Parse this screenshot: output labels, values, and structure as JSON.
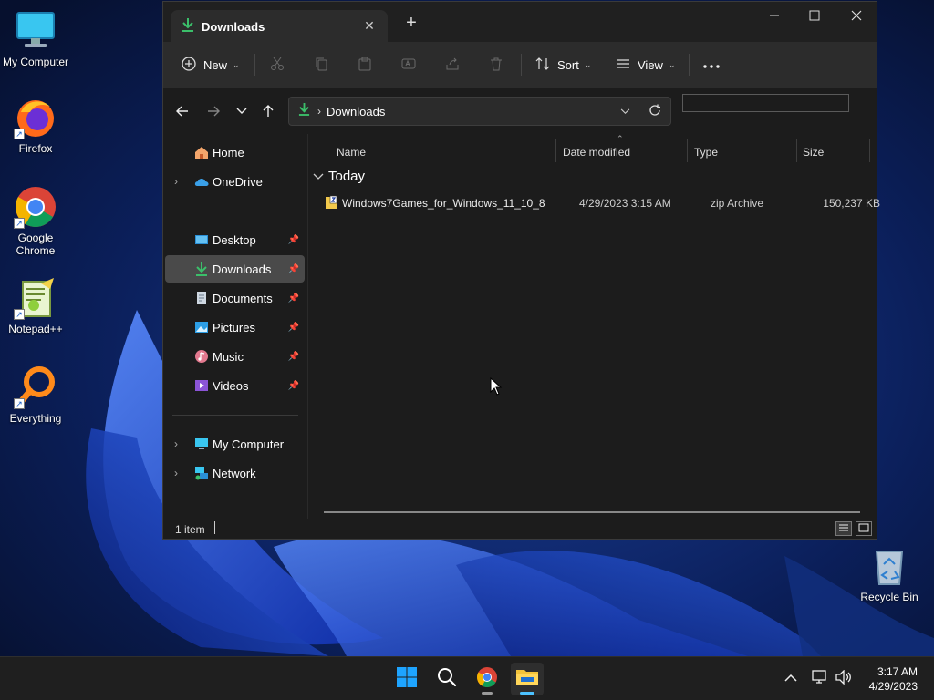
{
  "desktop": {
    "icons": [
      {
        "label": "My Computer",
        "icon": "monitor-icon"
      },
      {
        "label": "Firefox",
        "icon": "firefox-icon"
      },
      {
        "label": "Google Chrome",
        "icon": "chrome-icon"
      },
      {
        "label": "Notepad++",
        "icon": "notepadpp-icon"
      },
      {
        "label": "Everything",
        "icon": "everything-search-icon"
      },
      {
        "label": "Recycle Bin",
        "icon": "recycle-bin-icon"
      }
    ]
  },
  "explorer": {
    "tab": {
      "label": "Downloads",
      "icon": "download-arrow-icon"
    },
    "window_controls": [
      "minimize",
      "maximize",
      "close"
    ],
    "toolbar": {
      "new_label": "New",
      "sort_label": "Sort",
      "view_label": "View",
      "icons": [
        "cut-icon",
        "copy-icon",
        "paste-icon",
        "rename-icon",
        "share-icon",
        "delete-icon",
        "more-icon"
      ]
    },
    "address": {
      "current": "Downloads",
      "search_value": ""
    },
    "nav": {
      "quick": [
        {
          "label": "Home",
          "icon": "home-icon"
        },
        {
          "label": "OneDrive",
          "icon": "onedrive-icon"
        }
      ],
      "pinned": [
        {
          "label": "Desktop",
          "icon": "desktop-folder-icon",
          "pinned": true
        },
        {
          "label": "Downloads",
          "icon": "downloads-folder-icon",
          "pinned": true,
          "selected": true
        },
        {
          "label": "Documents",
          "icon": "documents-folder-icon",
          "pinned": true
        },
        {
          "label": "Pictures",
          "icon": "pictures-folder-icon",
          "pinned": true
        },
        {
          "label": "Music",
          "icon": "music-folder-icon",
          "pinned": true
        },
        {
          "label": "Videos",
          "icon": "videos-folder-icon",
          "pinned": true
        }
      ],
      "locations": [
        {
          "label": "My Computer",
          "icon": "computer-icon"
        },
        {
          "label": "Network",
          "icon": "network-icon"
        }
      ]
    },
    "columns": [
      "Name",
      "Date modified",
      "Type",
      "Size"
    ],
    "group_label": "Today",
    "files": [
      {
        "name": "Windows7Games_for_Windows_11_10_8",
        "date": "4/29/2023 3:15 AM",
        "type": "zip Archive",
        "size": "150,237 KB"
      }
    ],
    "status": {
      "item_count": "1 item"
    }
  },
  "taskbar": {
    "apps": [
      "windows-start-icon",
      "search-icon",
      "chrome-icon",
      "file-explorer-icon"
    ],
    "time": "3:17 AM",
    "date": "4/29/2023"
  },
  "colors": {
    "accent": "#4cc2ff",
    "window_bg": "#1c1c1c",
    "toolbar_bg": "#2c2c2c",
    "download_green": "#3bbf6a"
  }
}
